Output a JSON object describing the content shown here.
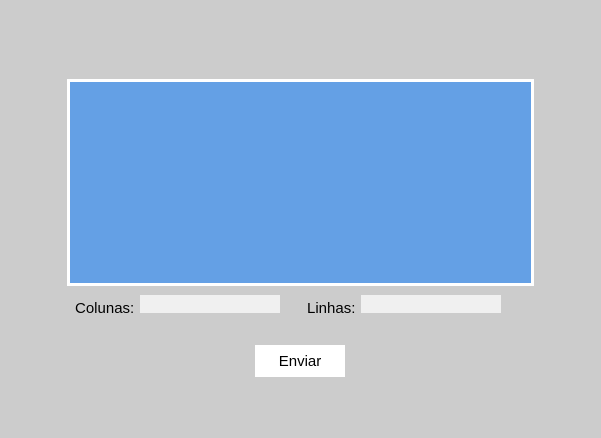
{
  "canvas": {
    "fill_color": "#64a0e5",
    "border_color": "#ffffff"
  },
  "form": {
    "columns": {
      "label": "Colunas:",
      "value": ""
    },
    "rows": {
      "label": "Linhas:",
      "value": ""
    },
    "submit_label": "Enviar"
  },
  "colors": {
    "background": "#cccccc",
    "input_background": "#f0f0f0",
    "button_background": "#ffffff"
  }
}
